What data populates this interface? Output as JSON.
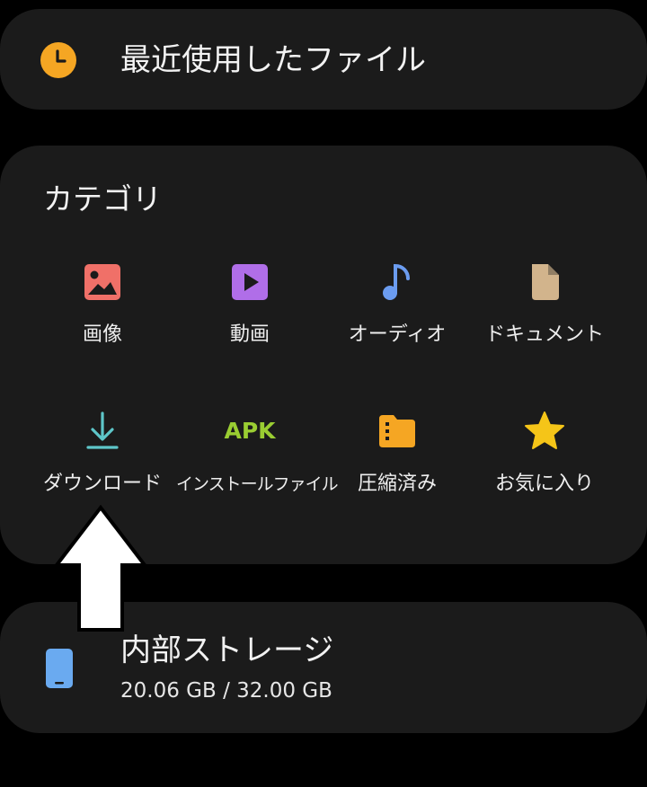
{
  "recent": {
    "label": "最近使用したファイル",
    "icon": "clock-icon",
    "icon_color": "#f5a623"
  },
  "categories": {
    "title": "カテゴリ",
    "items": [
      {
        "label": "画像",
        "icon": "image-icon",
        "color": "#f07068"
      },
      {
        "label": "動画",
        "icon": "video-play-icon",
        "color": "#b06ee8"
      },
      {
        "label": "オーディオ",
        "icon": "music-note-icon",
        "color": "#6b9cf0"
      },
      {
        "label": "ドキュメント",
        "icon": "document-icon",
        "color": "#d2b48c"
      },
      {
        "label": "ダウンロード",
        "icon": "download-icon",
        "color": "#5ec6c9"
      },
      {
        "label": "インストールファイル",
        "icon": "apk-icon",
        "icon_text": "APK",
        "color": "#9acd32"
      },
      {
        "label": "圧縮済み",
        "icon": "zip-folder-icon",
        "color": "#f5a623"
      },
      {
        "label": "お気に入り",
        "icon": "star-icon",
        "color": "#f5c518"
      }
    ]
  },
  "storage": {
    "title": "内部ストレージ",
    "usage": "20.06 GB / 32.00 GB",
    "icon": "phone-icon",
    "icon_color": "#6aaaf0"
  },
  "overlay": {
    "icon": "up-arrow-icon"
  }
}
